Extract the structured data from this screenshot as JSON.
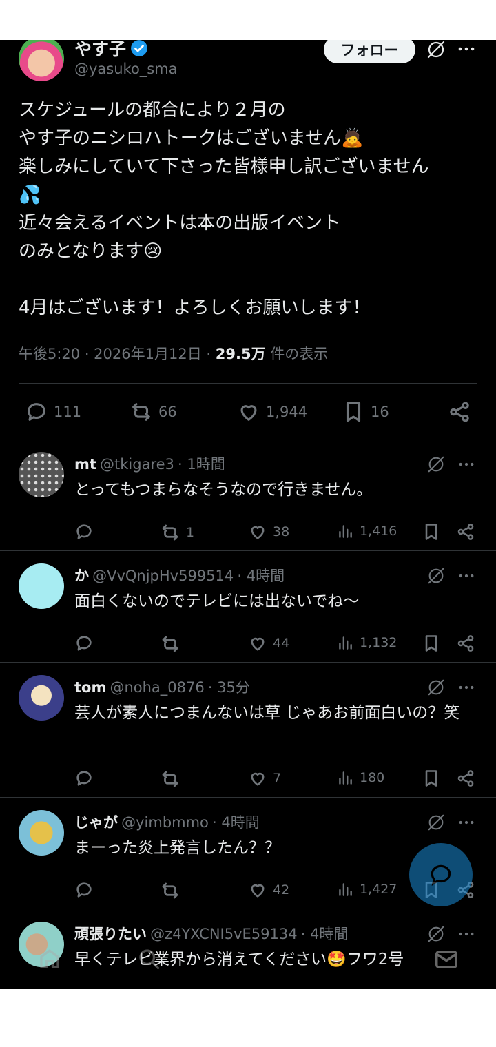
{
  "tweet": {
    "author_name": "やす子",
    "author_handle": "@yasuko_sma",
    "follow_label": "フォロー",
    "lines": [
      "スケジュールの都合により２月の",
      "やす子のニシロハトークはございません🙇",
      "楽しみにしていて下さった皆様申し訳ございません",
      "💦",
      "近々会えるイベントは本の出版イベント",
      "のみとなります😢",
      "",
      "4月はございます！よろしくお願いします！"
    ],
    "time": "午後5:20 · 2026年1月12日 · ",
    "views": "29.5万",
    "views_label": " 件の表示",
    "stats": {
      "replies": "111",
      "retweets": "66",
      "likes": "1,944",
      "bookmarks": "16"
    }
  },
  "replies": [
    {
      "name": "mt",
      "handle": "@tkigare3",
      "time": "· 1時間",
      "text": "とってもつまらなそうなので行きません。",
      "retweets": "1",
      "likes": "38",
      "views": "1,416"
    },
    {
      "name": "か",
      "handle": "@VvQnjpHv599514",
      "time": "· 4時間",
      "text": "面白くないのでテレビには出ないでね〜",
      "retweets": "",
      "likes": "44",
      "views": "1,132"
    },
    {
      "name": "tom",
      "handle": "@noha_0876",
      "time": "· 35分",
      "text": "芸人が素人につまんないは草 じゃあお前面白いの？笑",
      "retweets": "",
      "likes": "7",
      "views": "180"
    },
    {
      "name": "じゃが",
      "handle": "@yimbmmo",
      "time": "· 4時間",
      "text": "まーった炎上発言したん？？",
      "retweets": "",
      "likes": "42",
      "views": "1,427"
    },
    {
      "name": "頑張りたい",
      "handle": "@z4YXCNI5vE59134",
      "time": "· 4時間",
      "text": "早くテレビ業界から消えてください🤩フワ2号",
      "retweets": "",
      "likes": "",
      "views": ""
    }
  ],
  "colors": {
    "background": "#000000",
    "text": "#e7e9ea",
    "muted": "#71767b",
    "verified": "#1d9bf0",
    "fab": "#1a8cd8"
  },
  "icons": [
    "grok-icon",
    "more-icon",
    "reply-icon",
    "retweet-icon",
    "like-icon",
    "bookmark-icon",
    "share-icon",
    "views-icon",
    "verified-badge-icon",
    "compose-fab-icon",
    "home-icon",
    "search-icon",
    "mail-icon"
  ]
}
